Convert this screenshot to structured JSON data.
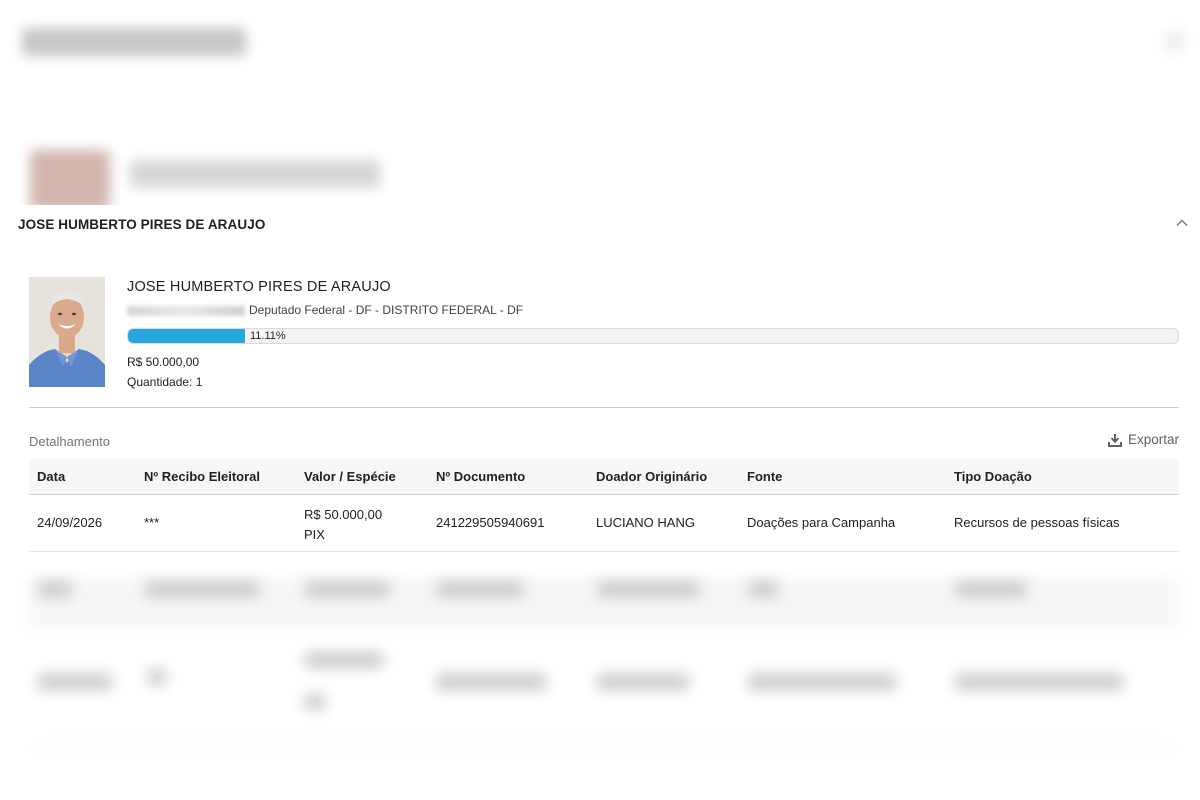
{
  "panel": {
    "header": "JOSE HUMBERTO PIRES DE ARAUJO"
  },
  "candidate": {
    "name": "JOSE HUMBERTO PIRES DE ARAUJO",
    "role": "Deputado Federal - DF - DISTRITO FEDERAL - DF",
    "progress_percent": 11.11,
    "progress_label": "11.11%",
    "amount": "R$ 50.000,00",
    "quantity": "Quantidade: 1"
  },
  "details": {
    "section_label": "Detalhamento",
    "export_label": "Exportar",
    "columns": [
      "Data",
      "Nº Recibo Eleitoral",
      "Valor / Espécie",
      "Nº Documento",
      "Doador Originário",
      "Fonte",
      "Tipo Doação"
    ],
    "rows": [
      {
        "data": "24/09/2026",
        "recibo": "***",
        "valor": "R$ 50.000,00",
        "especie": "PIX",
        "documento": "241229505940691",
        "doador": "LUCIANO HANG",
        "fonte": "Doações para Campanha",
        "tipo": "Recursos de pessoas físicas"
      }
    ]
  },
  "colors": {
    "progress_fill": "#27a6dc",
    "header_bg": "#f7f7f7"
  }
}
